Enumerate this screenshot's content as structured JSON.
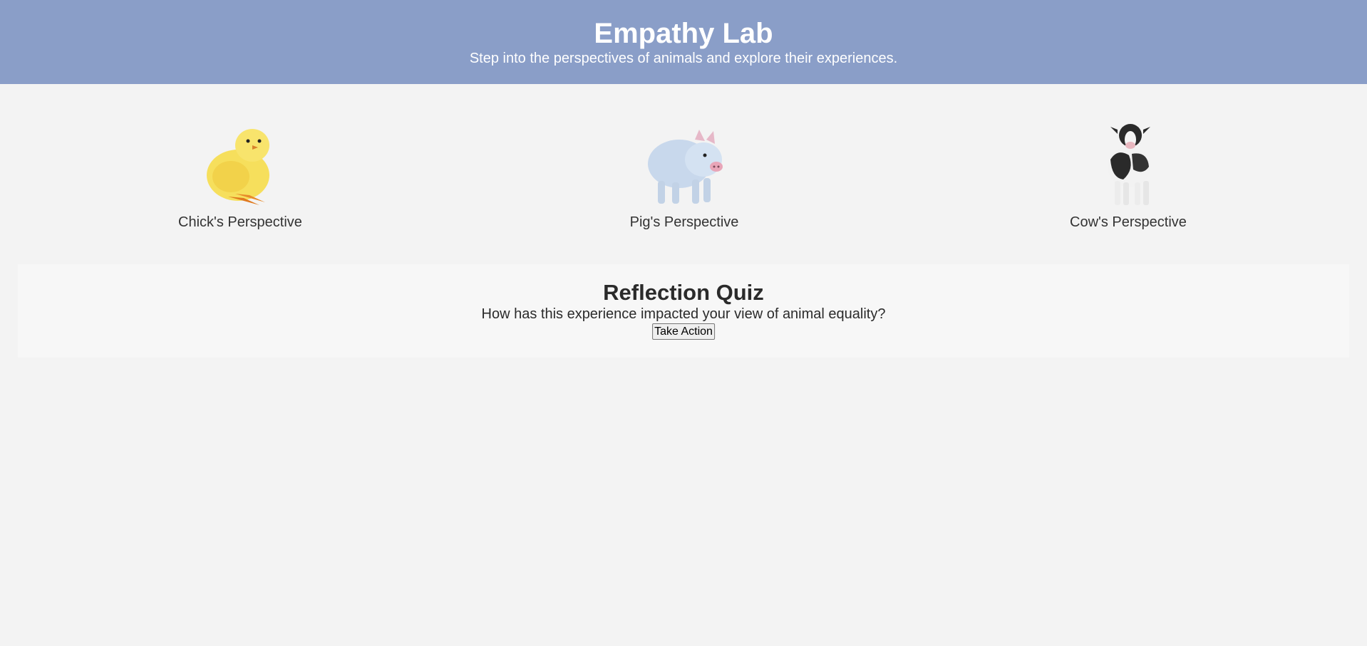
{
  "header": {
    "title": "Empathy Lab",
    "subtitle": "Step into the perspectives of animals and explore their experiences."
  },
  "animals": [
    {
      "label": "Chick's Perspective",
      "icon": "chick-image"
    },
    {
      "label": "Pig's Perspective",
      "icon": "pig-image"
    },
    {
      "label": "Cow's Perspective",
      "icon": "cow-image"
    }
  ],
  "quiz": {
    "title": "Reflection Quiz",
    "question": "How has this experience impacted your view of animal equality?",
    "button_label": "Take Action"
  },
  "colors": {
    "header_bg": "#8a9ec8",
    "page_bg": "#f3f3f3",
    "quiz_bg": "#f7f7f7"
  }
}
